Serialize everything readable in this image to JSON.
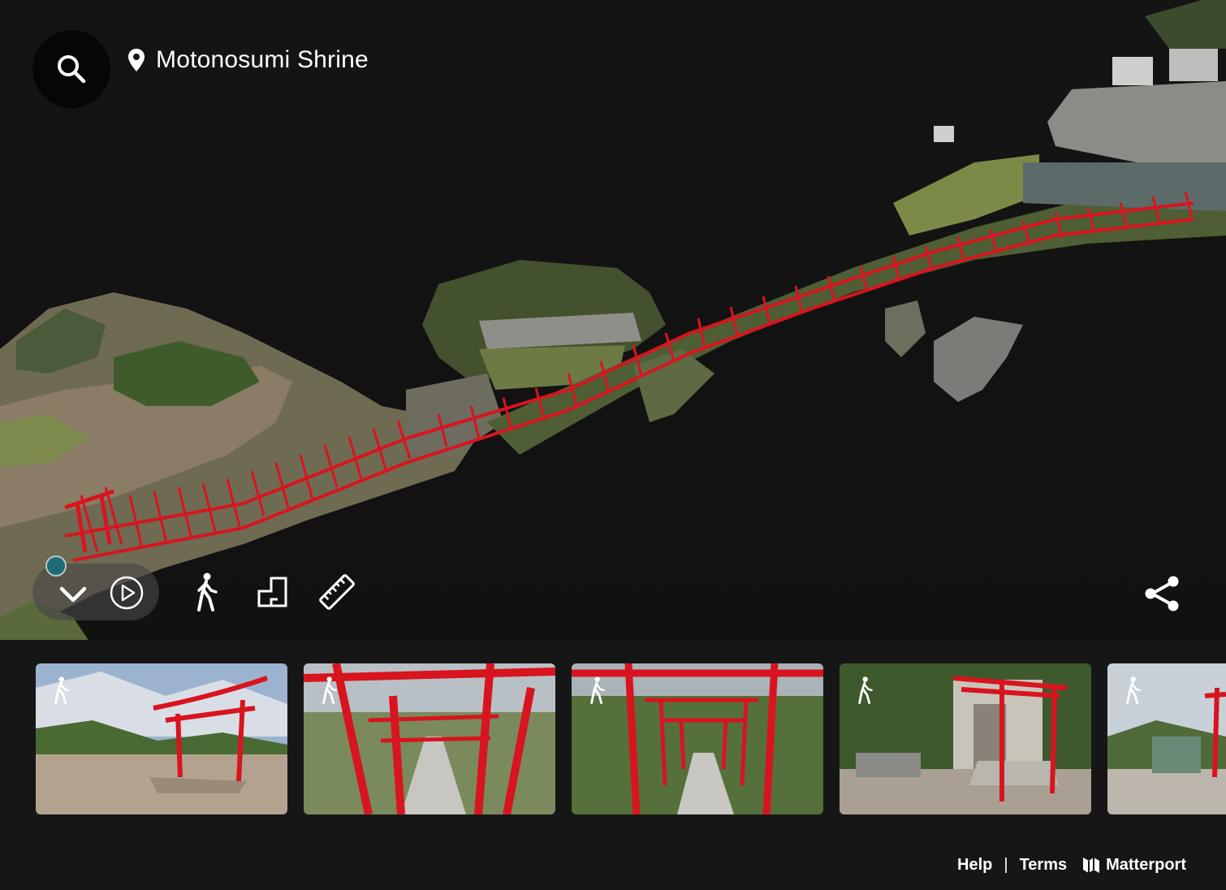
{
  "header": {
    "title": "Motonosumi Shrine",
    "search_icon": "search-icon",
    "pin_icon": "map-pin-icon"
  },
  "toolbar": {
    "collapse_icon": "chevron-down-icon",
    "play_icon": "play-circle-icon",
    "walk_icon": "walk-icon",
    "floorplan_icon": "floorplan-icon",
    "measure_icon": "ruler-icon",
    "share_icon": "share-icon"
  },
  "thumbnails": [
    {
      "id": 1,
      "icon": "walk-icon"
    },
    {
      "id": 2,
      "icon": "walk-icon"
    },
    {
      "id": 3,
      "icon": "walk-icon"
    },
    {
      "id": 4,
      "icon": "walk-icon"
    },
    {
      "id": 5,
      "icon": "walk-icon"
    }
  ],
  "footer": {
    "help": "Help",
    "separator": "|",
    "terms": "Terms",
    "brand": "Matterport"
  },
  "colors": {
    "torii_red": "#d8141f",
    "background": "#151515",
    "foliage": "#5f7a3a",
    "ground": "#8a7b68"
  }
}
